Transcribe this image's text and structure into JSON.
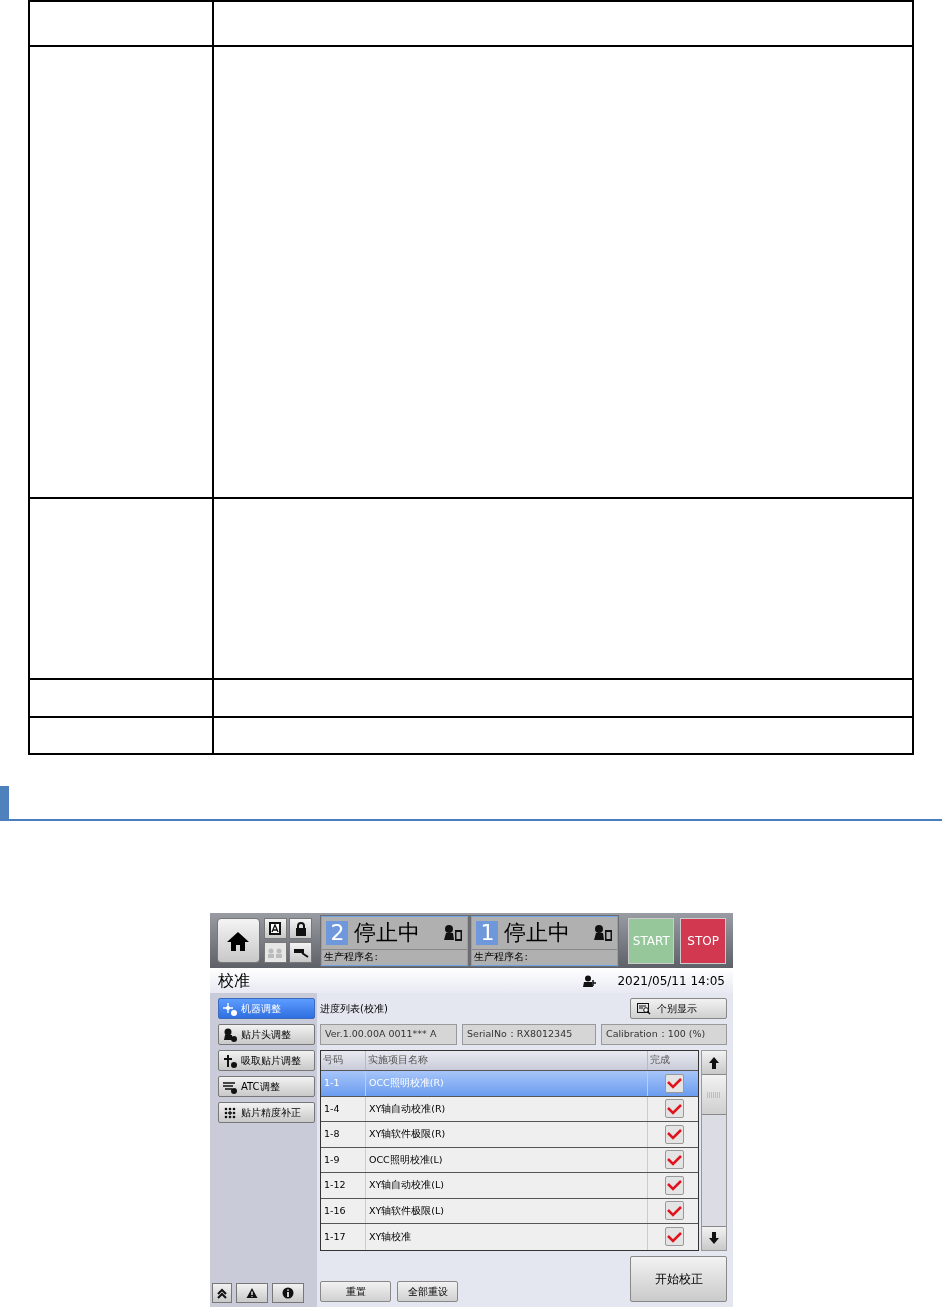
{
  "app": {
    "status_panels": [
      {
        "number": "2",
        "state": "停止中",
        "program_label": "生产程序名:"
      },
      {
        "number": "1",
        "state": "停止中",
        "program_label": "生产程序名:"
      }
    ],
    "start_button": "START",
    "stop_button": "STOP",
    "title": "校准",
    "datetime": "2021/05/11 14:05",
    "sidebar": {
      "items": [
        {
          "label": "机器调整",
          "selected": true
        },
        {
          "label": "贴片头调整",
          "selected": false
        },
        {
          "label": "吸取贴片调整",
          "selected": false
        },
        {
          "label": "ATC调整",
          "selected": false
        },
        {
          "label": "贴片精度补正",
          "selected": false
        }
      ]
    },
    "list_title": "进度列表(校准)",
    "detail_button": "个别显示",
    "info": [
      "Ver.1.00.00A 0011*** A",
      "SerialNo：RX8012345",
      "Calibration：100 (%)"
    ],
    "table": {
      "columns": [
        "号码",
        "实施项目名称",
        "完成"
      ],
      "rows": [
        {
          "number": "1-1",
          "name": "OCC照明校准(R)",
          "done": true,
          "selected": true
        },
        {
          "number": "1-4",
          "name": "XY轴自动校准(R)",
          "done": true,
          "selected": false
        },
        {
          "number": "1-8",
          "name": "XY轴软件极限(R)",
          "done": true,
          "selected": false
        },
        {
          "number": "1-9",
          "name": "OCC照明校准(L)",
          "done": true,
          "selected": false
        },
        {
          "number": "1-12",
          "name": "XY轴自动校准(L)",
          "done": true,
          "selected": false
        },
        {
          "number": "1-16",
          "name": "XY轴软件极限(L)",
          "done": true,
          "selected": false
        },
        {
          "number": "1-17",
          "name": "XY轴校准",
          "done": true,
          "selected": false
        }
      ]
    },
    "bottom_buttons": [
      "重置",
      "全部重设"
    ],
    "start_calibration_button": "开始校正"
  }
}
